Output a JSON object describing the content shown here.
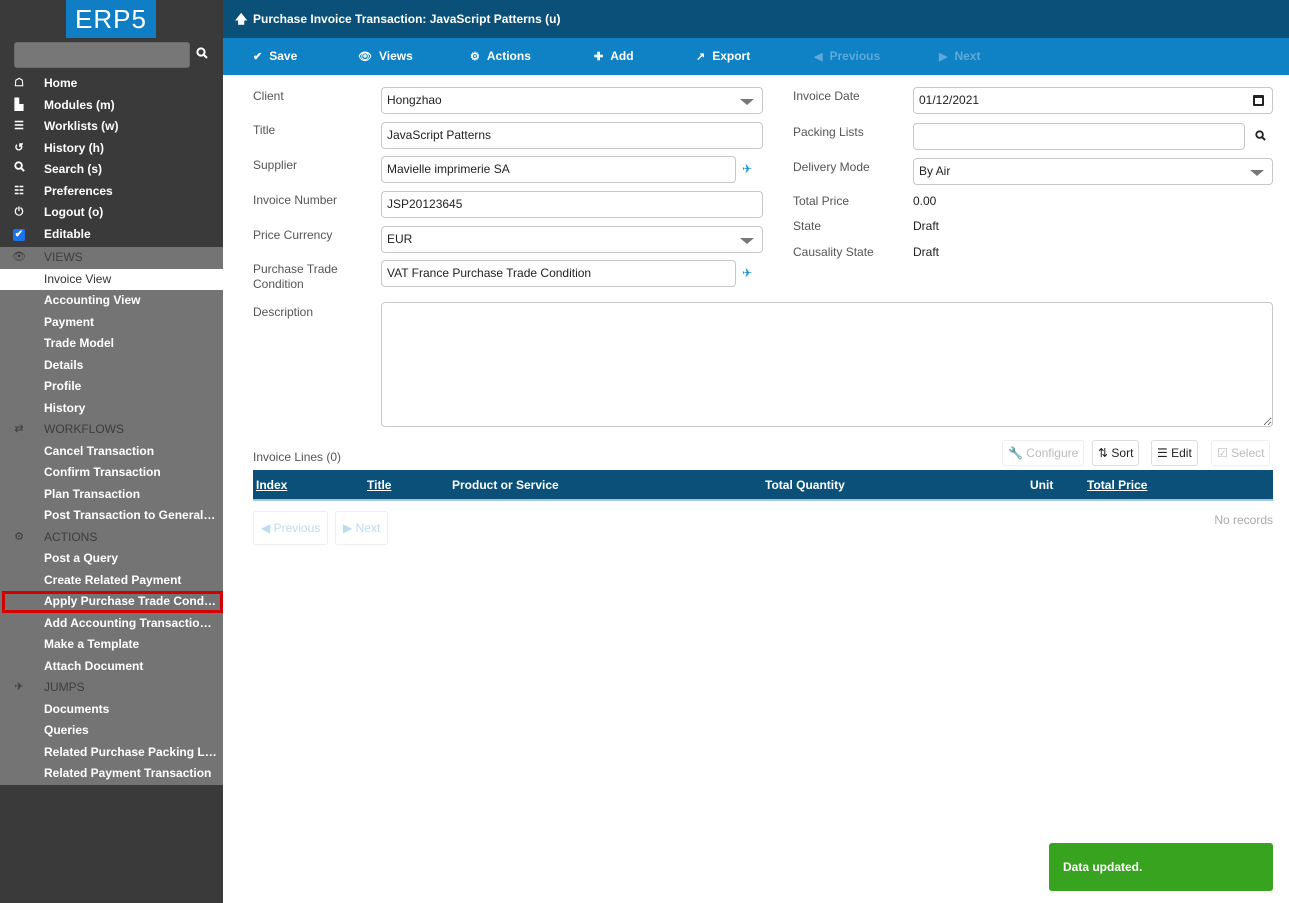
{
  "logo": "ERP5",
  "sidebar": {
    "search_placeholder": "",
    "main_items": [
      {
        "label": "Home",
        "icon": "home-icon",
        "glyph": "🏠"
      },
      {
        "label": "Modules (m)",
        "icon": "puzzle-icon",
        "glyph": "▙"
      },
      {
        "label": "Worklists (w)",
        "icon": "tasks-icon",
        "glyph": "☰"
      },
      {
        "label": "History (h)",
        "icon": "history-icon",
        "glyph": "↺"
      },
      {
        "label": "Search (s)",
        "icon": "search-icon",
        "glyph": "🔍"
      },
      {
        "label": "Preferences",
        "icon": "sliders-icon",
        "glyph": "☷"
      },
      {
        "label": "Logout (o)",
        "icon": "power-icon",
        "glyph": "⏻"
      },
      {
        "label": "Editable",
        "icon": "checkbox-icon",
        "glyph": "✔"
      }
    ],
    "views_header": "VIEWS",
    "views": [
      "Invoice View",
      "Accounting View",
      "Payment",
      "Trade Model",
      "Details",
      "Profile",
      "History"
    ],
    "workflows_header": "WORKFLOWS",
    "workflows": [
      "Cancel Transaction",
      "Confirm Transaction",
      "Plan Transaction",
      "Post Transaction to General L..."
    ],
    "actions_header": "ACTIONS",
    "actions": [
      "Post a Query",
      "Create Related Payment",
      "Apply Purchase Trade Conditi...",
      "Add Accounting Transaction L...",
      "Make a Template",
      "Attach Document"
    ],
    "jumps_header": "JUMPS",
    "jumps": [
      "Documents",
      "Queries",
      "Related Purchase Packing List",
      "Related Payment Transaction"
    ]
  },
  "header": {
    "title": "Purchase Invoice Transaction: JavaScript Patterns (u)"
  },
  "toolbar": {
    "save": "Save",
    "views": "Views",
    "actions": "Actions",
    "add": "Add",
    "export": "Export",
    "previous": "Previous",
    "next": "Next"
  },
  "form": {
    "client_label": "Client",
    "client_value": "Hongzhao",
    "title_label": "Title",
    "title_value": "JavaScript Patterns",
    "supplier_label": "Supplier",
    "supplier_value": "Mavielle imprimerie SA",
    "invoice_number_label": "Invoice Number",
    "invoice_number_value": "JSP20123645",
    "price_currency_label": "Price Currency",
    "price_currency_value": "EUR",
    "trade_condition_label_1": "Purchase Trade",
    "trade_condition_label_2": "Condition",
    "trade_condition_value": "VAT France Purchase Trade Condition",
    "description_label": "Description",
    "description_value": "",
    "invoice_date_label": "Invoice Date",
    "invoice_date_value": "01/12/2021",
    "packing_lists_label": "Packing Lists",
    "packing_lists_value": "",
    "delivery_mode_label": "Delivery Mode",
    "delivery_mode_value": "By Air",
    "total_price_label": "Total Price",
    "total_price_value": "0.00",
    "state_label": "State",
    "state_value": "Draft",
    "causality_label": "Causality State",
    "causality_value": "Draft"
  },
  "listbox": {
    "title": "Invoice Lines (0)",
    "configure": "Configure",
    "sort": "Sort",
    "edit": "Edit",
    "select": "Select",
    "columns": [
      "Index",
      "Title",
      "Product or Service",
      "Total Quantity",
      "Unit",
      "Total Price"
    ],
    "previous": "Previous",
    "next": "Next",
    "empty": "No records"
  },
  "toast": "Data updated."
}
